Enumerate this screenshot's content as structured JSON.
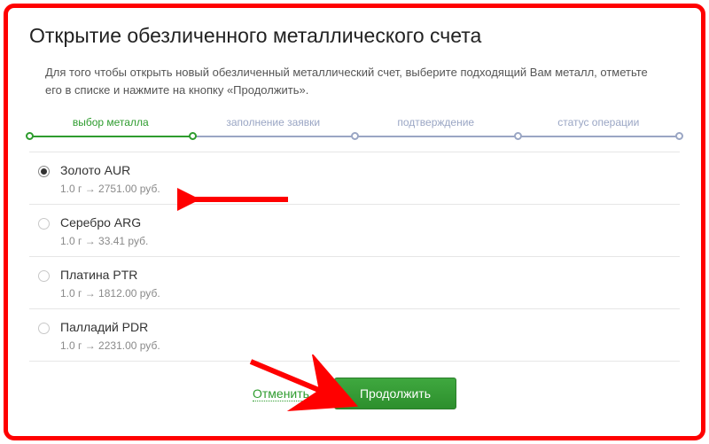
{
  "title": "Открытие обезличенного металлического счета",
  "intro": "Для того чтобы открыть новый обезличенный металлический счет, выберите подходящий Вам металл, отметьте его в списке и нажмите на кнопку «Продолжить».",
  "steps": {
    "s1": "выбор металла",
    "s2": "заполнение заявки",
    "s3": "подтверждение",
    "s4": "статус операции"
  },
  "metals": [
    {
      "name": "Золото AUR",
      "price": "1.0 г → 2751.00 руб.",
      "selected": true
    },
    {
      "name": "Серебро ARG",
      "price": "1.0 г → 33.41 руб.",
      "selected": false
    },
    {
      "name": "Платина PTR",
      "price": "1.0 г → 1812.00 руб.",
      "selected": false
    },
    {
      "name": "Палладий PDR",
      "price": "1.0 г → 2231.00 руб.",
      "selected": false
    }
  ],
  "actions": {
    "cancel": "Отменить",
    "continue": "Продолжить"
  }
}
